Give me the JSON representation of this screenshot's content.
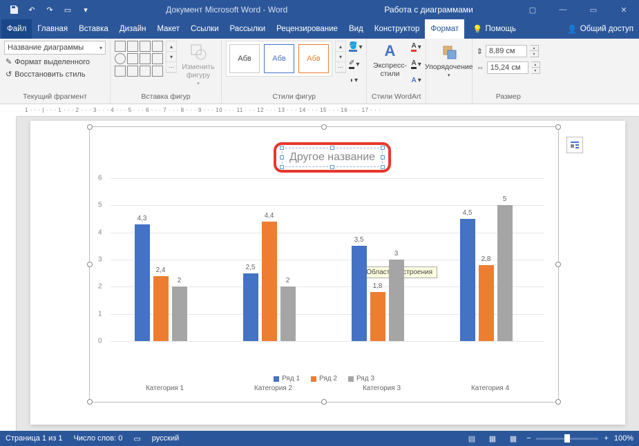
{
  "titlebar": {
    "doc_title": "Документ Microsoft Word - Word",
    "context_title": "Работа с диаграммами"
  },
  "tabs": {
    "file": "Файл",
    "home": "Главная",
    "insert": "Вставка",
    "design": "Дизайн",
    "layout": "Макет",
    "references": "Ссылки",
    "mailings": "Рассылки",
    "review": "Рецензирование",
    "view": "Вид",
    "constructor": "Конструктор",
    "format": "Формат",
    "help": "Помощь",
    "share": "Общий доступ"
  },
  "ribbon": {
    "current_selection": {
      "label": "Текущий фрагмент",
      "dropdown": "Название диаграммы",
      "format_selection": "Формат выделенного",
      "reset_style": "Восстановить стиль"
    },
    "insert_shapes": {
      "label": "Вставка фигур",
      "change_shape": "Изменить фигуру"
    },
    "shape_styles": {
      "label": "Стили фигур",
      "sample": "Абв"
    },
    "wordart": {
      "label": "Стили WordArt",
      "express": "Экспресс-стили"
    },
    "arrange": {
      "label": "",
      "btn": "Упорядочение"
    },
    "size": {
      "label": "Размер",
      "height": "8,89 см",
      "width": "15,24 см"
    }
  },
  "chart_data": {
    "type": "bar",
    "title": "Другое название",
    "categories": [
      "Категория 1",
      "Категория 2",
      "Категория 3",
      "Категория 4"
    ],
    "series": [
      {
        "name": "Ряд 1",
        "values": [
          4.3,
          2.5,
          3.5,
          4.5
        ],
        "color": "#4472c4"
      },
      {
        "name": "Ряд 2",
        "values": [
          2.4,
          4.4,
          1.8,
          2.8
        ],
        "color": "#ed7d31"
      },
      {
        "name": "Ряд 3",
        "values": [
          2,
          2,
          3,
          5
        ],
        "color": "#a5a5a5"
      }
    ],
    "ylim": [
      0,
      6
    ],
    "yticks": [
      0,
      1,
      2,
      3,
      4,
      5,
      6
    ],
    "tooltip": "Область построения"
  },
  "ruler_h": "1 · · · | · · · 1 · · · 2 · · · 3 · · · 4 · · · 5 · · · 6 · · · 7 · · · 8 · · · 9 · · · 10 · · · 11 · · · 12 · · · 13 · · · 14 · · · 15 · · · 16 · · · 17 · · ·",
  "status": {
    "page": "Страница 1 из 1",
    "words": "Число слов: 0",
    "lang": "русский",
    "zoom": "100%"
  }
}
